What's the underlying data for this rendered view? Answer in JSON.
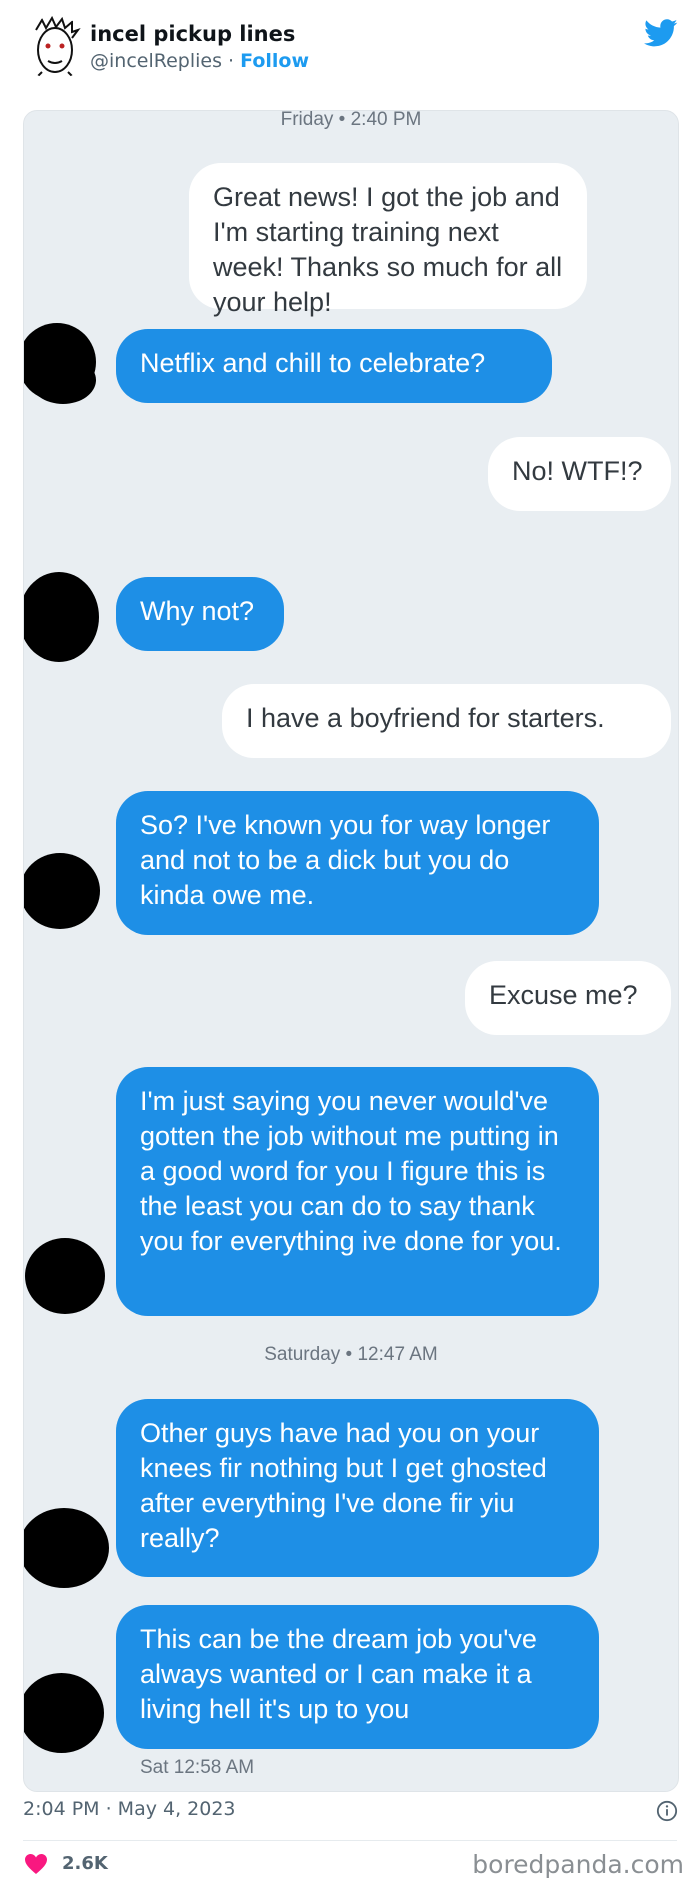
{
  "tweet": {
    "author_name": "incel pickup lines",
    "author_handle": "@incelReplies",
    "separator": " · ",
    "follow_label": "Follow",
    "timestamp": "2:04 PM · May 4, 2023",
    "likes": "2.6K",
    "watermark": "boredpanda.com",
    "colors": {
      "accent": "#1d9bf0",
      "heart": "#f91880",
      "bubble_blue": "#1e8fe6"
    }
  },
  "chat": {
    "day_1": "Friday • 2:40 PM",
    "day_2": "Saturday • 12:47 AM",
    "sent_time": "Sat 12:58 AM",
    "messages": [
      {
        "from": "me",
        "text": "Great news! I got the job and I'm starting training next week! Thanks so much for all your help!"
      },
      {
        "from": "them",
        "text": "Netflix and chill to celebrate?"
      },
      {
        "from": "me",
        "text": "No! WTF!?"
      },
      {
        "from": "them",
        "text": "Why not?"
      },
      {
        "from": "me",
        "text": "I have a boyfriend for starters."
      },
      {
        "from": "them",
        "text": "So? I've known you for way longer and not to be a dick but you do kinda owe me."
      },
      {
        "from": "me",
        "text": "Excuse me?"
      },
      {
        "from": "them",
        "text": "I'm just saying you never would've gotten the job without me putting in a good word for you I figure this is the least you can do to say thank you for everything ive done for you."
      },
      {
        "from": "them",
        "text": "Other guys have had you on your knees fir nothing but I get ghosted after everything I've done fir yiu really?"
      },
      {
        "from": "them",
        "text": "This can be the dream job you've always wanted or I can make it a living hell it's up to you"
      }
    ]
  }
}
